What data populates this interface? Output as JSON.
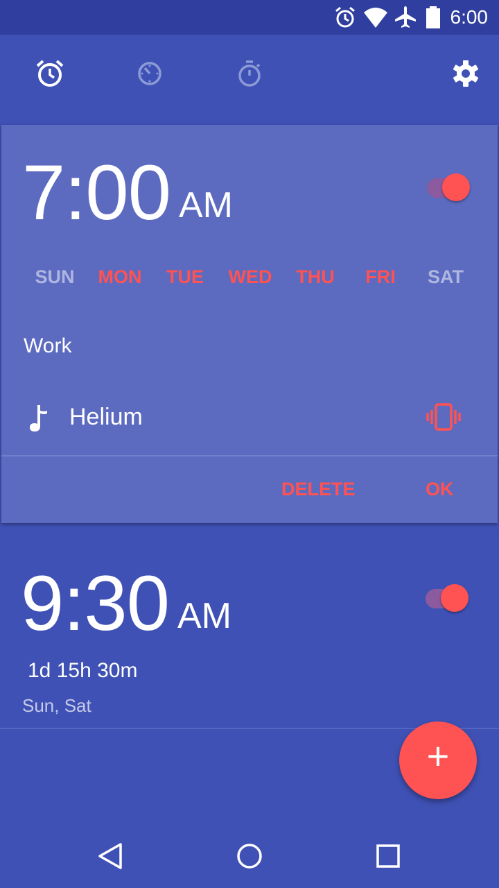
{
  "status_bar": {
    "time": "6:00",
    "icons": [
      "alarm-icon",
      "wifi-icon",
      "airplane-icon",
      "battery-icon"
    ]
  },
  "toolbar": {
    "tabs": [
      "alarm-tab-icon",
      "clock-tab-icon",
      "timer-tab-icon",
      "stopwatch-tab-icon"
    ],
    "settings_icon": "gear-icon"
  },
  "alarms": [
    {
      "hour_minute": "7:00",
      "ampm": "AM",
      "enabled": true,
      "expanded": true,
      "days": [
        {
          "label": "SUN",
          "on": false
        },
        {
          "label": "MON",
          "on": true
        },
        {
          "label": "TUE",
          "on": true
        },
        {
          "label": "WED",
          "on": true
        },
        {
          "label": "THU",
          "on": true
        },
        {
          "label": "FRI",
          "on": true
        },
        {
          "label": "SAT",
          "on": false
        }
      ],
      "label": "Work",
      "ringtone": "Helium",
      "vibrate": true,
      "actions": {
        "delete": "DELETE",
        "ok": "OK"
      }
    },
    {
      "hour_minute": "9:30",
      "ampm": "AM",
      "enabled": true,
      "expanded": false,
      "countdown": "1d 15h 30m",
      "repeat_summary": "Sun, Sat"
    }
  ],
  "fab": {
    "label": "+"
  },
  "colors": {
    "primary": "#3f51b5",
    "primary_dark": "#303f9f",
    "card": "#5c6bc0",
    "accent": "#ff5252"
  }
}
